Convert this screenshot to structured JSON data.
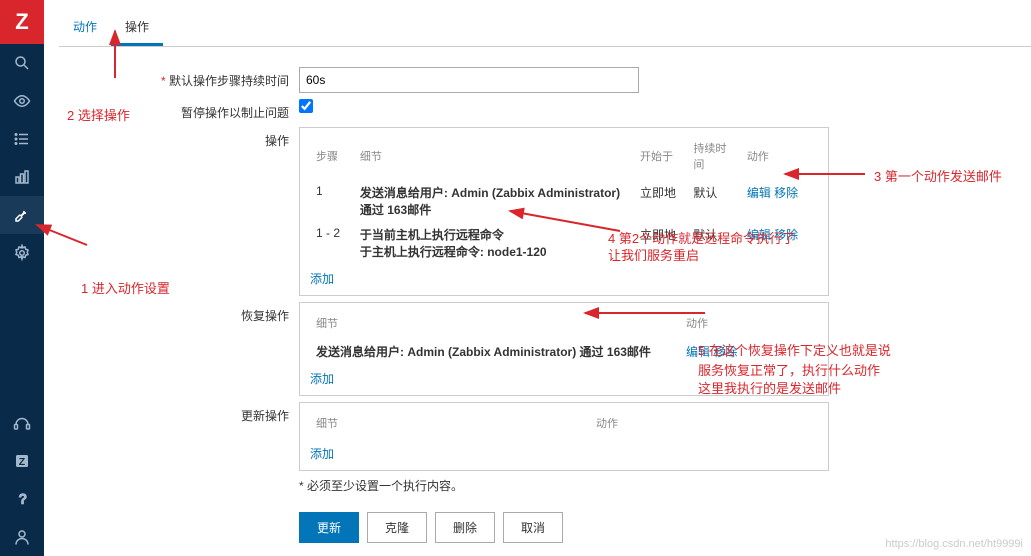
{
  "sidebar": {
    "logo": "Z"
  },
  "tabs": {
    "t1": "动作",
    "t2": "操作"
  },
  "labels": {
    "duration": "默认操作步骤持续时间",
    "pause": "暂停操作以制止问题",
    "ops": "操作",
    "recovery": "恢复操作",
    "update": "更新操作"
  },
  "fields": {
    "duration_value": "60s"
  },
  "headers": {
    "step": "步骤",
    "detail": "细节",
    "start": "开始于",
    "dur": "持续时间",
    "act": "动作"
  },
  "links": {
    "edit": "编辑",
    "remove": "移除",
    "add": "添加"
  },
  "ops": {
    "r1_step": "1",
    "r1_detail": "发送消息给用户: Admin (Zabbix Administrator) 通过 163邮件",
    "r1_start": "立即地",
    "r1_dur": "默认",
    "r2_step": "1 - 2",
    "r2_d1": "于当前主机上执行远程命令",
    "r2_d2": "于主机上执行远程命令: node1-120",
    "r2_start": "立即地",
    "r2_dur": "默认"
  },
  "recovery": {
    "r1_detail": "发送消息给用户: Admin (Zabbix Administrator) 通过 163邮件"
  },
  "note": "必须至少设置一个执行内容。",
  "buttons": {
    "update": "更新",
    "clone": "克隆",
    "delete": "删除",
    "cancel": "取消"
  },
  "ann": {
    "a1": "1 进入动作设置",
    "a2": "2 选择操作",
    "a3": "3 第一个动作发送邮件",
    "a4a": "4  第2个动作就是远程命令执行了",
    "a4b": "让我们服务重启",
    "a5a": "5 在这个恢复操作下定义也就是说",
    "a5b": "服务恢复正常了，执行什么动作",
    "a5c": "这里我执行的是发送邮件"
  },
  "watermark": "https://blog.csdn.net/ht9999i"
}
